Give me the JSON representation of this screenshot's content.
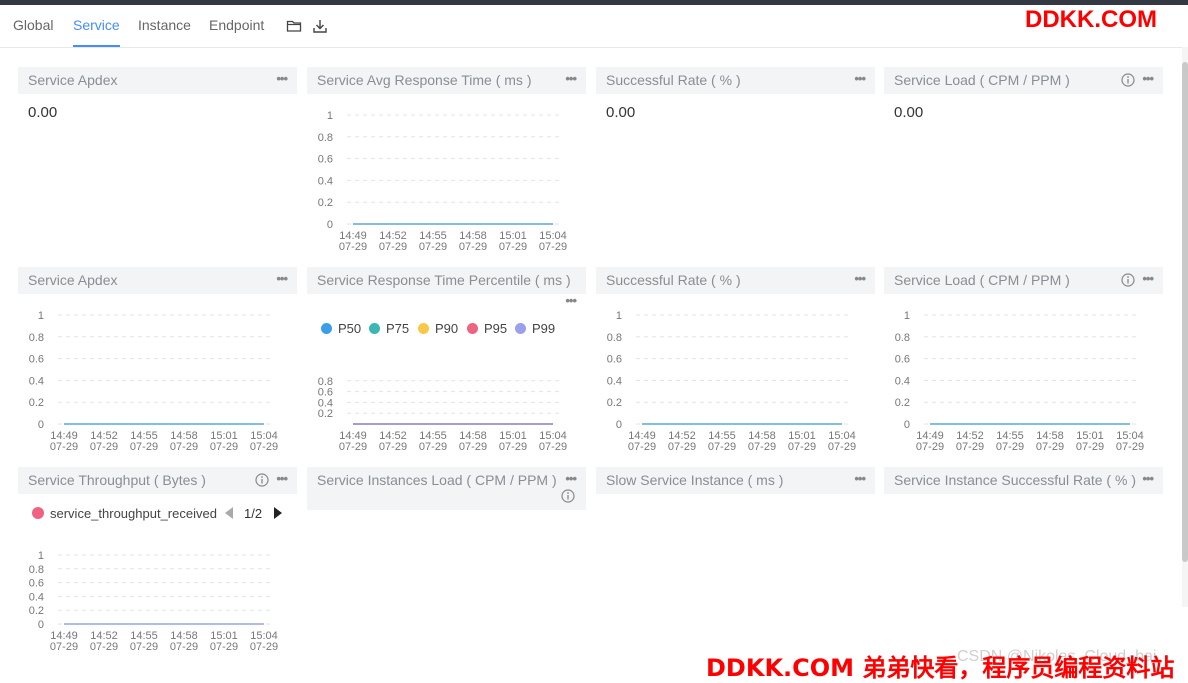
{
  "tabs": [
    "Global",
    "Service",
    "Instance",
    "Endpoint"
  ],
  "active_tab": 1,
  "icons": {
    "folder": "folder-icon",
    "download": "download-icon",
    "info": "info-icon",
    "menu": "more-icon"
  },
  "colors": {
    "accent": "#448dfe",
    "line": "#5aa7d8",
    "p50": "#3a9ee8",
    "p75": "#3ab7b0",
    "p90": "#f9c848",
    "p95": "#f06380",
    "p99": "#9aa0ec",
    "throughput": "#f06380"
  },
  "panels": [
    {
      "title": "Service Apdex",
      "value": "0.00"
    },
    {
      "title": "Service Avg Response Time ( ms )"
    },
    {
      "title": "Successful Rate ( % )",
      "value": "0.00"
    },
    {
      "title": "Service Load ( CPM / PPM )",
      "value": "0.00"
    },
    {
      "title": "Service Apdex"
    },
    {
      "title": "Service Response Time Percentile ( ms )"
    },
    {
      "title": "Successful Rate ( % )"
    },
    {
      "title": "Service Load ( CPM / PPM )"
    },
    {
      "title": "Service Throughput ( Bytes )"
    },
    {
      "title": "Service Instances Load ( CPM / PPM )"
    },
    {
      "title": "Slow Service Instance ( ms )"
    },
    {
      "title": "Service Instance Successful Rate ( % )"
    }
  ],
  "percentile_legend": [
    "P50",
    "P75",
    "P90",
    "P95",
    "P99"
  ],
  "throughput_legend": {
    "label": "service_throughput_received",
    "page": "1/2"
  },
  "chart_data": [
    {
      "type": "line",
      "title": "Service Avg Response Time ( ms )",
      "x": [
        "14:49 07-29",
        "14:52 07-29",
        "14:55 07-29",
        "14:58 07-29",
        "15:01 07-29",
        "15:04 07-29"
      ],
      "series": [
        {
          "values": [
            0,
            0,
            0,
            0,
            0,
            0
          ]
        }
      ],
      "ylim": [
        0,
        1
      ],
      "yticks": [
        "0",
        "0.2",
        "0.4",
        "0.6",
        "0.8",
        "1"
      ]
    },
    {
      "type": "line",
      "title": "Service Apdex",
      "x": [
        "14:49 07-29",
        "14:52 07-29",
        "14:55 07-29",
        "14:58 07-29",
        "15:01 07-29",
        "15:04 07-29"
      ],
      "series": [
        {
          "values": [
            0,
            0,
            0,
            0,
            0,
            0
          ]
        }
      ],
      "ylim": [
        0,
        1
      ],
      "yticks": [
        "0",
        "0.2",
        "0.4",
        "0.6",
        "0.8",
        "1"
      ]
    },
    {
      "type": "line",
      "title": "Service Response Time Percentile ( ms )",
      "x": [
        "14:49 07-29",
        "14:52 07-29",
        "14:55 07-29",
        "14:58 07-29",
        "15:01 07-29",
        "15:04 07-29"
      ],
      "series": [
        {
          "name": "P50",
          "values": [
            0,
            0,
            0,
            0,
            0,
            0
          ]
        },
        {
          "name": "P75",
          "values": [
            0,
            0,
            0,
            0,
            0,
            0
          ]
        },
        {
          "name": "P90",
          "values": [
            0,
            0,
            0,
            0,
            0,
            0
          ]
        },
        {
          "name": "P95",
          "values": [
            0,
            0,
            0,
            0,
            0,
            0
          ]
        },
        {
          "name": "P99",
          "values": [
            0,
            0,
            0,
            0,
            0,
            0
          ]
        }
      ],
      "ylim": [
        0,
        1
      ],
      "yticks": [
        "0.2",
        "0.4",
        "0.6",
        "0.8"
      ]
    },
    {
      "type": "line",
      "title": "Successful Rate ( % )",
      "x": [
        "14:49 07-29",
        "14:52 07-29",
        "14:55 07-29",
        "14:58 07-29",
        "15:01 07-29",
        "15:04 07-29"
      ],
      "series": [
        {
          "values": [
            0,
            0,
            0,
            0,
            0,
            0
          ]
        }
      ],
      "ylim": [
        0,
        1
      ],
      "yticks": [
        "0",
        "0.2",
        "0.4",
        "0.6",
        "0.8",
        "1"
      ]
    },
    {
      "type": "line",
      "title": "Service Load ( CPM / PPM )",
      "x": [
        "14:49 07-29",
        "14:52 07-29",
        "14:55 07-29",
        "14:58 07-29",
        "15:01 07-29",
        "15:04 07-29"
      ],
      "series": [
        {
          "values": [
            0,
            0,
            0,
            0,
            0,
            0
          ]
        }
      ],
      "ylim": [
        0,
        1
      ],
      "yticks": [
        "0",
        "0.2",
        "0.4",
        "0.6",
        "0.8",
        "1"
      ]
    },
    {
      "type": "line",
      "title": "Service Throughput ( Bytes )",
      "x": [
        "14:49 07-29",
        "14:52 07-29",
        "14:55 07-29",
        "14:58 07-29",
        "15:01 07-29",
        "15:04 07-29"
      ],
      "series": [
        {
          "name": "service_throughput_received",
          "values": [
            0,
            0,
            0,
            0,
            0,
            0
          ]
        }
      ],
      "ylim": [
        0,
        1
      ],
      "yticks": [
        "0",
        "0.2",
        "0.4",
        "0.6",
        "0.8",
        "1"
      ]
    }
  ],
  "watermarks": {
    "top": "DDKK.COM",
    "bottom": "DDKK.COM 弟弟快看，程序员编程资料站",
    "faint": "CSDN @Nikolas_Cloud_bai"
  }
}
